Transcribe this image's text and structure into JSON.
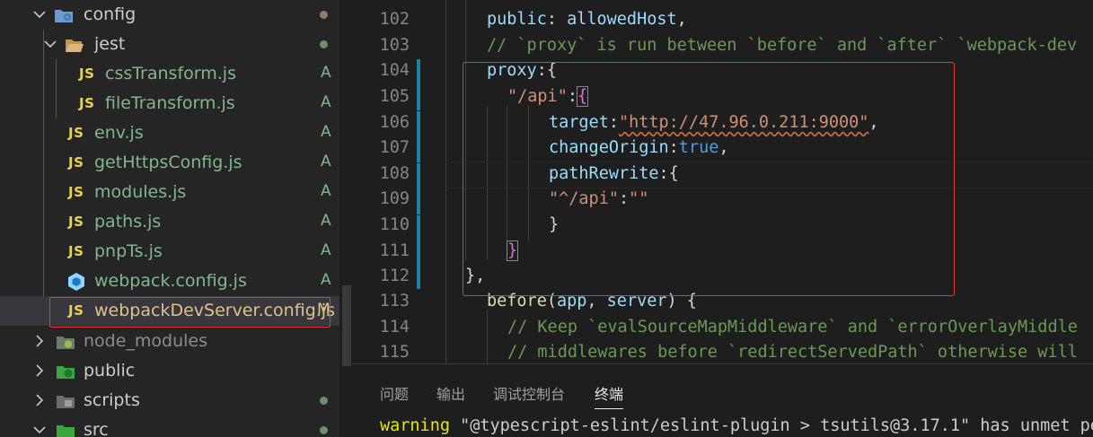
{
  "explorer": {
    "items": [
      {
        "name": "config",
        "type": "folder-open",
        "git": ""
      },
      {
        "name": "jest",
        "type": "folder-open",
        "git": ""
      },
      {
        "name": "cssTransform.js",
        "type": "js",
        "git": "A"
      },
      {
        "name": "fileTransform.js",
        "type": "js",
        "git": "A"
      },
      {
        "name": "env.js",
        "type": "js",
        "git": "A"
      },
      {
        "name": "getHttpsConfig.js",
        "type": "js",
        "git": "A"
      },
      {
        "name": "modules.js",
        "type": "js",
        "git": "A"
      },
      {
        "name": "paths.js",
        "type": "js",
        "git": "A"
      },
      {
        "name": "pnpTs.js",
        "type": "js",
        "git": "A"
      },
      {
        "name": "webpack.config.js",
        "type": "webpack",
        "git": "A"
      },
      {
        "name": "webpackDevServer.config.js",
        "type": "js",
        "git": "M"
      },
      {
        "name": "node_modules",
        "type": "folder-closed",
        "git": ""
      },
      {
        "name": "public",
        "type": "folder-closed",
        "git": ""
      },
      {
        "name": "scripts",
        "type": "folder-closed",
        "git": ""
      },
      {
        "name": "src",
        "type": "folder-closed",
        "git": ""
      }
    ],
    "js_label": "JS"
  },
  "editor": {
    "line_numbers": [
      "102",
      "103",
      "104",
      "105",
      "106",
      "107",
      "108",
      "109",
      "110",
      "111",
      "112",
      "113",
      "114",
      "115"
    ],
    "code": {
      "l102_kw": "public",
      "l102_rest": ": ",
      "l102_val": "allowedHost",
      "l102_end": ",",
      "l103": "// `proxy` is run between `before` and `after` `webpack-dev",
      "l104_kw": "proxy",
      "l104_rest": ":{",
      "l105_str": "\"/api\"",
      "l105_colon": ":",
      "l105_brace": "{",
      "l106_kw": "target",
      "l106_colon": ":",
      "l106_str": "\"http://47.96.0.211:9000\"",
      "l106_end": ",",
      "l107_kw": "changeOrigin",
      "l107_colon": ":",
      "l107_bool": "true",
      "l107_end": ",",
      "l108_kw": "pathRewrite",
      "l108_rest": ":{",
      "l109_str1": "\"^/api\"",
      "l109_colon": ":",
      "l109_str2": "\"\"",
      "l110": "}",
      "l111": "}",
      "l112": "},",
      "l113_fn": "before",
      "l113_p1": "(",
      "l113_a1": "app",
      "l113_comma": ", ",
      "l113_a2": "server",
      "l113_end": ") {",
      "l114": "// Keep `evalSourceMapMiddleware` and `errorOverlayMiddle",
      "l115": "// middlewares before `redirectServedPath` otherwise will"
    }
  },
  "panel": {
    "tabs": [
      "问题",
      "输出",
      "调试控制台",
      "终端"
    ],
    "active_tab": "终端",
    "terminal_warn": "warning",
    "terminal_text": " \"@typescript-eslint/eslint-plugin > tsutils@3.17.1\" has unmet pe"
  },
  "colors": {
    "js_icon": "#e8d44d",
    "git_added": "#81b88b",
    "git_modified": "#e2c08d",
    "highlight_box": "#e03b3b"
  }
}
